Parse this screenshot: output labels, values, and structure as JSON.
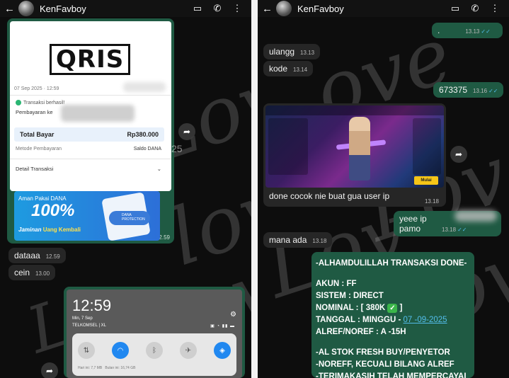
{
  "left": {
    "contact_name": "KenFavboy",
    "receipt": {
      "logo": "QRIS",
      "date": "07 Sep 2025 · 12:59",
      "status": "Transaksi berhasil!",
      "paid_to_label": "Pembayaran ke",
      "total_label": "Total Bayar",
      "total_value": "Rp380.000",
      "method_label": "Metode Pembayaran",
      "method_value": "Saldo DANA",
      "detail_label": "Detail Transaksi",
      "banner_line1": "Aman Pakai DANA",
      "banner_big": "100%",
      "banner_line3_prefix": "Jaminan ",
      "banner_line3_highlight": "Uang Kembali",
      "protection": "DANA PROTECTION",
      "time": "12.59"
    },
    "messages": [
      {
        "text": "dataaa",
        "time": "12.59"
      },
      {
        "text": "cein",
        "time": "13.00"
      }
    ],
    "wall_char": "25",
    "phone": {
      "clock": "12:59",
      "date": "Min, 7 Sep",
      "carrier": "TELKOMSEL | XL",
      "data1": "Hari ini: 7,7 MB",
      "data2": "Bulan ini: 16,74 GB"
    }
  },
  "right": {
    "contact_name": "KenFavboy",
    "top_out": {
      "text": ".",
      "time": "13.13"
    },
    "in1": {
      "text": "ulangg",
      "time": "13.13"
    },
    "in2": {
      "text": "kode",
      "time": "13.14"
    },
    "out_code": {
      "text": "673375",
      "time": "13.16"
    },
    "game_caption": "done cocok nie buat gua user ip",
    "game_time": "13.18",
    "game_button": "Mulai",
    "yeee": {
      "text": "yeee ip pamo",
      "time": "13.18"
    },
    "mana": {
      "text": "mana ada",
      "time": "13.18"
    },
    "summary": {
      "title": "-ALHAMDULILLAH TRANSAKSI DONE-",
      "akun": "AKUN : FF",
      "sistem": "SISTEM : DIRECT",
      "nominal_prefix": "NOMINAL : [ 380K ",
      "nominal_suffix": " ]",
      "tanggal_prefix": "TANGGAL : MINGGU - ",
      "tanggal_date": "07 -09-2025",
      "alref": "ALREF/NOREF : A -15H",
      "l1": "-AL STOK FRESH BUY/PENYETOR",
      "l2": "-NOREFF, KECUALI BILANG ALREF",
      "l3": "-TERIMAKASIH TELAH MEMPERCAYAI"
    }
  }
}
